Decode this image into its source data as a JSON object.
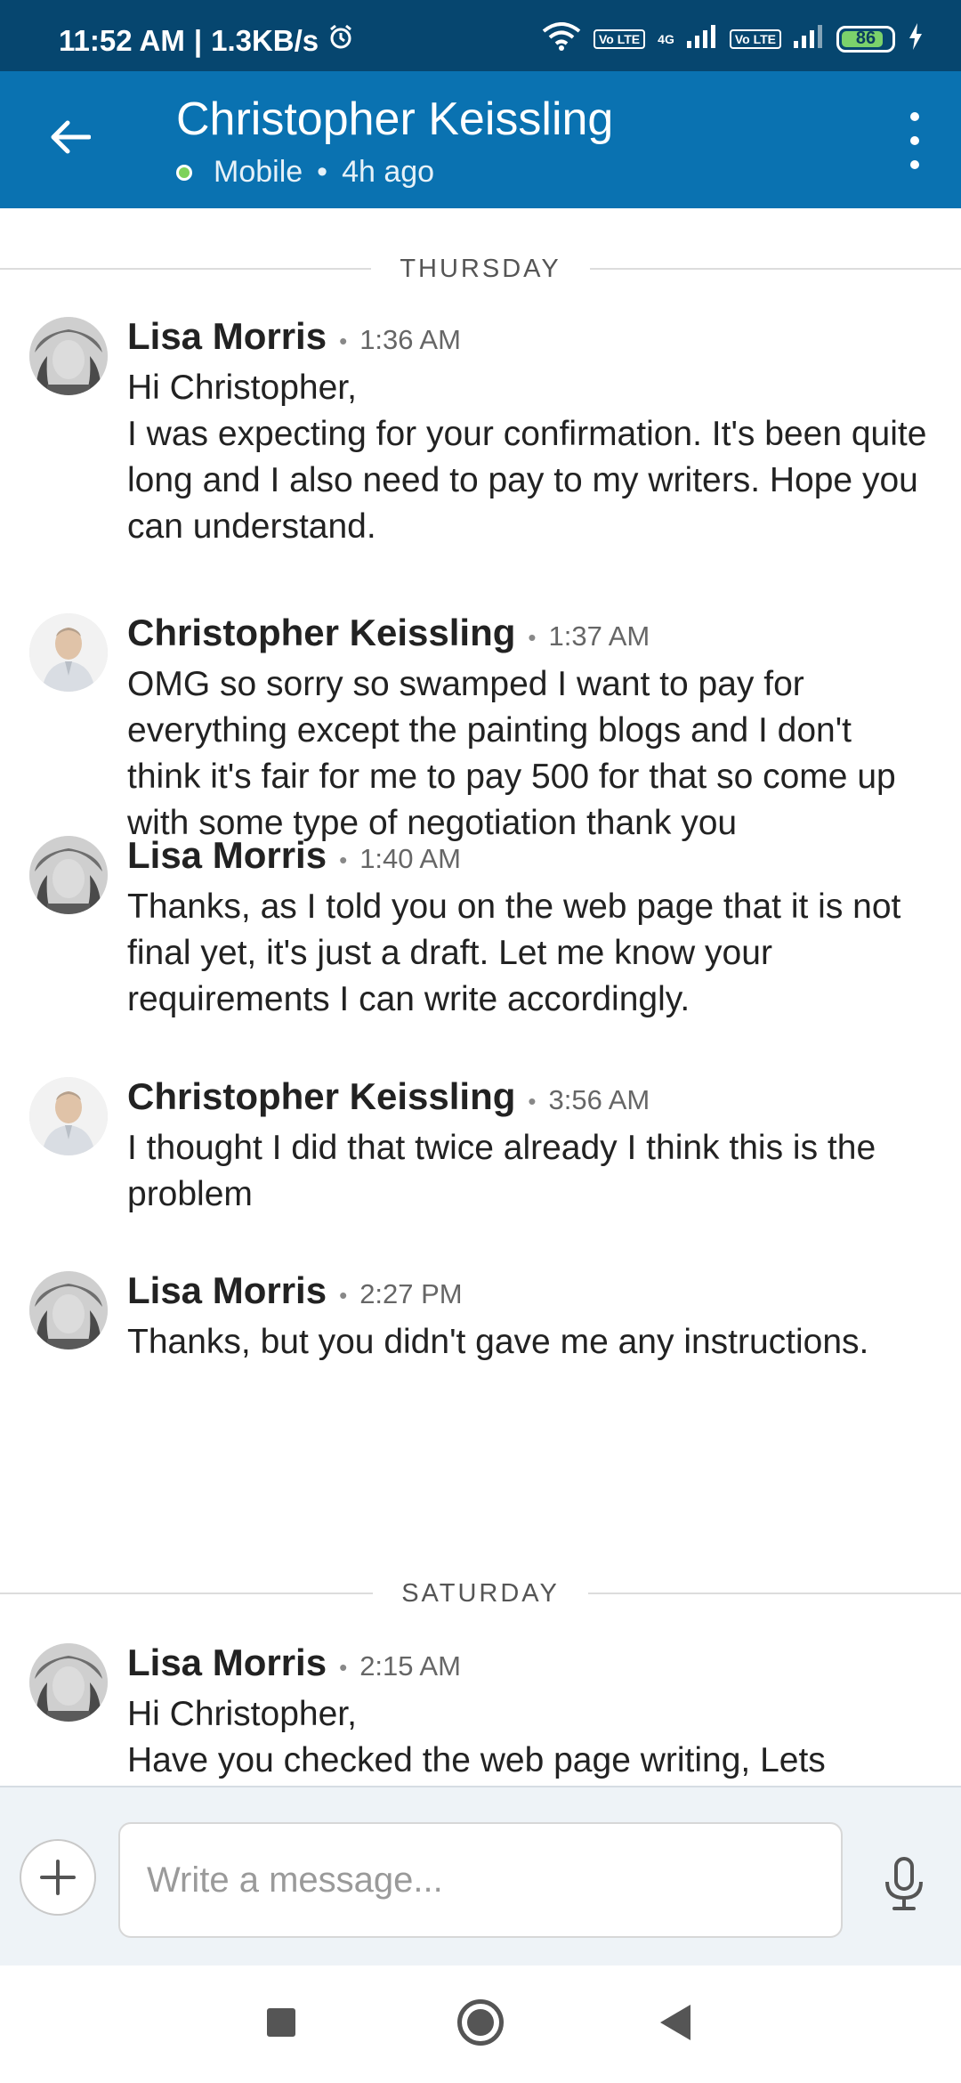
{
  "status_bar": {
    "time": "11:52 AM",
    "speed": "1.3KB/s",
    "network_4g": "4G",
    "volte_1": "Vo LTE",
    "volte_2": "Vo LTE",
    "battery": "86",
    "battery_level": 0.86,
    "icons": [
      "alarm-icon",
      "wifi-icon",
      "signal-icon",
      "charging-icon"
    ]
  },
  "header": {
    "title": "Christopher Keissling",
    "presence": "Mobile",
    "last_seen": "4h ago",
    "presence_color": "#7ed25a",
    "bg_color": "#0a72b1"
  },
  "days": [
    {
      "label": "THURSDAY"
    },
    {
      "label": "SATURDAY"
    }
  ],
  "messages": [
    {
      "sender": "Lisa Morris",
      "time": "1:36 AM",
      "avatar": "lisa",
      "text": "Hi Christopher,\nI was expecting for your confirmation. It's been quite long and I also need to pay to my writers. Hope you can understand."
    },
    {
      "sender": "Christopher Keissling",
      "time": "1:37 AM",
      "avatar": "chris",
      "text": "OMG so sorry so swamped I want to pay for everything except the painting blogs and I don't think it's fair for me to pay 500 for that so come up with some type of negotiation thank you"
    },
    {
      "sender": "Lisa Morris",
      "time": "1:40 AM",
      "avatar": "lisa",
      "text": "Thanks, as I told you on the web page that it is not final yet, it's just a draft. Let me know your requirements I can write accordingly."
    },
    {
      "sender": "Christopher Keissling",
      "time": "3:56 AM",
      "avatar": "chris",
      "text": "I thought I did that twice already I think this is the problem"
    },
    {
      "sender": "Lisa Morris",
      "time": "2:27 PM",
      "avatar": "lisa",
      "text": "Thanks, but you didn't gave me any instructions."
    },
    {
      "sender": "Lisa Morris",
      "time": "2:15 AM",
      "avatar": "lisa",
      "text": "Hi Christopher,\nHave you checked the web page writing, Lets"
    }
  ],
  "composer": {
    "placeholder": "Write a message..."
  }
}
